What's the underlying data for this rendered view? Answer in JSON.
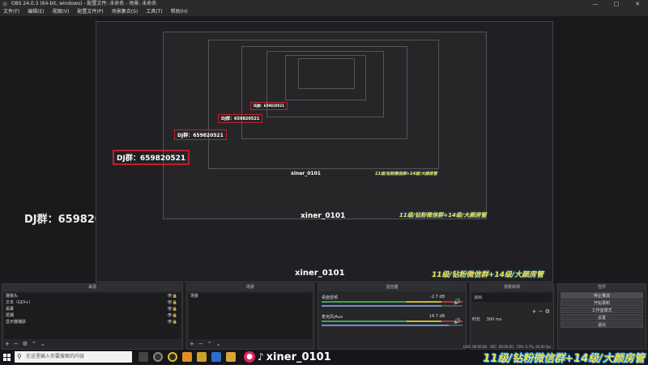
{
  "window": {
    "title": "OBS 24.0.3 (64-bit, windows) - 配置文件: 未命名 - 场景: 未命名",
    "controls": [
      "—",
      "□",
      "✕"
    ]
  },
  "menu": [
    "文件(F)",
    "编辑(E)",
    "视图(V)",
    "配置文件(P)",
    "场景集合(S)",
    "工具(T)",
    "帮助(H)"
  ],
  "overlay": {
    "dj_text": "DJ群：659820521",
    "tiktok_handle": "xiner_0101",
    "ad_text": "11级/钻粉微信群+14级/大颜房管"
  },
  "docks": {
    "sources": {
      "title": "来源",
      "items": [
        {
          "label": "摄像头"
        },
        {
          "label": "文本（GDI+）"
        },
        {
          "label": "黑幕"
        },
        {
          "label": "斑斓"
        },
        {
          "label": "显示器捕获"
        }
      ],
      "toolbar": [
        "+",
        "−",
        "⚙",
        "⌃",
        "⌄"
      ]
    },
    "scenes": {
      "title": "场景",
      "items": [
        {
          "label": "场景"
        }
      ],
      "toolbar": [
        "+",
        "−",
        "⌃",
        "⌄"
      ]
    },
    "mixer": {
      "title": "混音器",
      "tracks": [
        {
          "name": "桌面音频",
          "db": "-2.7 dB",
          "level": 0.85
        },
        {
          "name": "麦克风/Aux",
          "db": "14.7 dB",
          "level": 0.9
        }
      ]
    },
    "transitions": {
      "title": "场景转场",
      "selected": "淡出",
      "duration_label": "时长",
      "duration_value": "300 ms"
    },
    "controls": {
      "title": "控件",
      "buttons": [
        "停止推流",
        "开始录制",
        "工作室模式",
        "设置",
        "退出"
      ]
    }
  },
  "status": {
    "live": "LIVE: 00:00:00",
    "rec": "REC: 00:00:00",
    "cpu": "CPU: 6.7%, 60.00 fps"
  },
  "taskbar": {
    "search_placeholder": "在这里输入你要搜索的内容"
  },
  "colors": {
    "accent_red": "#c0202a",
    "ad_yellow": "#f7e04a",
    "ad_outline": "#0a7be0"
  }
}
